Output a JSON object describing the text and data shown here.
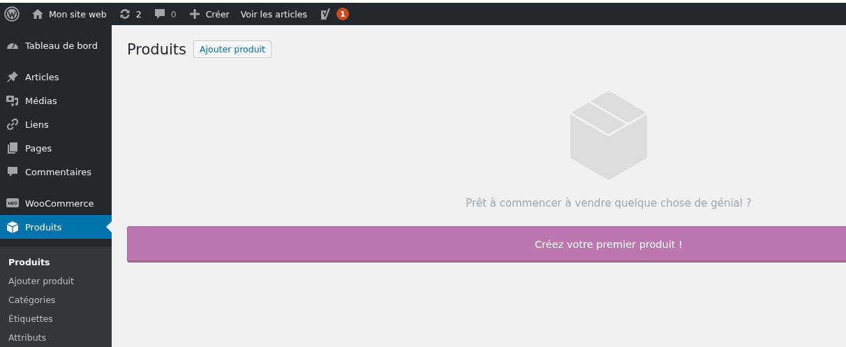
{
  "admin_bar": {
    "site_name": "Mon site web",
    "updates_count": "2",
    "comments_count": "0",
    "new_label": "Créer",
    "view_label": "Voir les articles",
    "seo_badge": "1"
  },
  "sidebar": {
    "groups": [
      [
        {
          "label": "Tableau de bord",
          "selected": false
        }
      ],
      [
        {
          "label": "Articles",
          "selected": false
        },
        {
          "label": "Médias",
          "selected": false
        },
        {
          "label": "Liens",
          "selected": false
        },
        {
          "label": "Pages",
          "selected": false
        },
        {
          "label": "Commentaires",
          "selected": false
        }
      ],
      [
        {
          "label": "WooCommerce",
          "selected": false
        },
        {
          "label": "Produits",
          "selected": true
        }
      ]
    ],
    "submenu": [
      {
        "label": "Produits",
        "selected": true
      },
      {
        "label": "Ajouter produit",
        "selected": false
      },
      {
        "label": "Catégories",
        "selected": false
      },
      {
        "label": "Étiquettes",
        "selected": false
      },
      {
        "label": "Attributs",
        "selected": false
      }
    ]
  },
  "page": {
    "title": "Produits",
    "add_button": "Ajouter produit",
    "empty_message": "Prêt à commencer à vendre quelque chose de génial ?",
    "cta_button": "Créez votre premier produit !"
  }
}
